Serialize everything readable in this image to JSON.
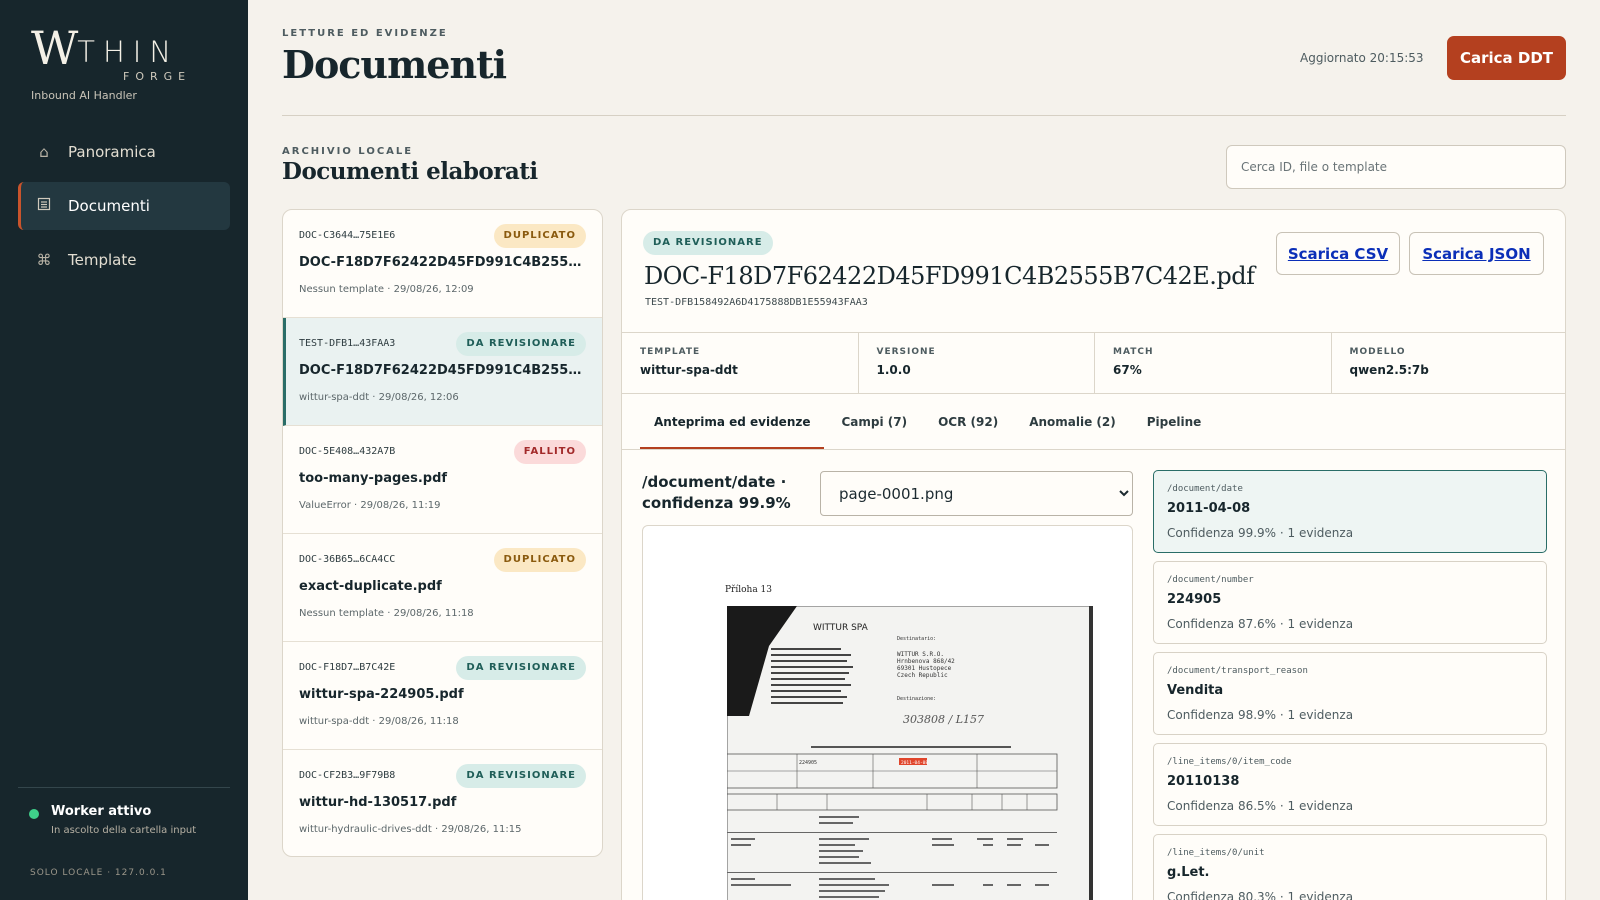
{
  "sidebar": {
    "brand": {
      "w": "W",
      "thin": "THIN",
      "forge": "FORGE",
      "subtitle": "Inbound AI Handler"
    },
    "nav": [
      {
        "label": "Panoramica",
        "icon": "home-icon",
        "active": false
      },
      {
        "label": "Documenti",
        "icon": "document-list-icon",
        "active": true
      },
      {
        "label": "Template",
        "icon": "command-icon",
        "active": false
      }
    ],
    "worker": {
      "title": "Worker attivo",
      "subtitle": "In ascolto della cartella input",
      "status_color": "#3fd08a"
    },
    "footer": "SOLO LOCALE · 127.0.0.1"
  },
  "header": {
    "eyebrow": "LETTURE ED EVIDENZE",
    "title": "Documenti",
    "updated": "Aggiornato 20:15:53",
    "upload_label": "Carica DDT"
  },
  "section": {
    "eyebrow": "ARCHIVIO LOCALE",
    "title": "Documenti elaborati",
    "search_placeholder": "Cerca ID, file o template"
  },
  "documents": [
    {
      "id": "DOC-C3644…75E1E6",
      "name": "DOC-F18D7F62422D45FD991C4B2555B7C42E.pdf",
      "meta": "Nessun template · 29/08/26, 12:09",
      "badge": "DUPLICATO",
      "badge_type": "dup",
      "selected": false
    },
    {
      "id": "TEST-DFB1…43FAA3",
      "name": "DOC-F18D7F62422D45FD991C4B2555B7C42E.pdf",
      "meta": "wittur-spa-ddt · 29/08/26, 12:06",
      "badge": "DA REVISIONARE",
      "badge_type": "rev",
      "selected": true
    },
    {
      "id": "DOC-5E408…432A7B",
      "name": "too-many-pages.pdf",
      "meta": "ValueError · 29/08/26, 11:19",
      "badge": "FALLITO",
      "badge_type": "fail",
      "selected": false
    },
    {
      "id": "DOC-36B65…6CA4CC",
      "name": "exact-duplicate.pdf",
      "meta": "Nessun template · 29/08/26, 11:18",
      "badge": "DUPLICATO",
      "badge_type": "dup",
      "selected": false
    },
    {
      "id": "DOC-F18D7…B7C42E",
      "name": "wittur-spa-224905.pdf",
      "meta": "wittur-spa-ddt · 29/08/26, 11:18",
      "badge": "DA REVISIONARE",
      "badge_type": "rev",
      "selected": false
    },
    {
      "id": "DOC-CF2B3…9F79B8",
      "name": "wittur-hd-130517.pdf",
      "meta": "wittur-hydraulic-drives-ddt · 29/08/26, 11:15",
      "badge": "DA REVISIONARE",
      "badge_type": "rev",
      "selected": false
    }
  ],
  "detail": {
    "badge": "DA REVISIONARE",
    "title": "DOC-F18D7F62422D45FD991C4B2555B7C42E.pdf",
    "subtitle": "TEST-DFB158492A6D4175888DB1E55943FAA3",
    "download_csv": "Scarica CSV",
    "download_json": "Scarica JSON",
    "meta": [
      {
        "label": "TEMPLATE",
        "value": "wittur-spa-ddt"
      },
      {
        "label": "VERSIONE",
        "value": "1.0.0"
      },
      {
        "label": "MATCH",
        "value": "67%"
      },
      {
        "label": "MODELLO",
        "value": "qwen2.5:7b"
      }
    ],
    "tabs": [
      {
        "label": "Anteprima ed evidenze",
        "active": true
      },
      {
        "label": "Campi (7)",
        "active": false
      },
      {
        "label": "OCR (92)",
        "active": false
      },
      {
        "label": "Anomalie (2)",
        "active": false
      },
      {
        "label": "Pipeline",
        "active": false
      }
    ],
    "evidence_title": "/document/date · confidenza 99.9%",
    "page_select": {
      "selected": "page-0001.png"
    },
    "preview": {
      "page_label": "Příloha 13",
      "company": "WITTUR SPA",
      "recipient_label": "Destinatario:",
      "recipient_lines": [
        "WITTUR S.R.O.",
        "Hrnbenova 868/42",
        "69301 Hustopece",
        "Czech Republic"
      ],
      "destination_label": "Destinazione:",
      "handwriting": "303808 / L157",
      "highlight": "2011-04-08",
      "ocr_number": "224905"
    },
    "fields": [
      {
        "path": "/document/date",
        "value": "2011-04-08",
        "confidence": "Confidenza 99.9% · 1 evidenza",
        "active": true
      },
      {
        "path": "/document/number",
        "value": "224905",
        "confidence": "Confidenza 87.6% · 1 evidenza",
        "active": false
      },
      {
        "path": "/document/transport_reason",
        "value": "Vendita",
        "confidence": "Confidenza 98.9% · 1 evidenza",
        "active": false
      },
      {
        "path": "/line_items/0/item_code",
        "value": "20110138",
        "confidence": "Confidenza 86.5% · 1 evidenza",
        "active": false
      },
      {
        "path": "/line_items/0/unit",
        "value": "g.Let.",
        "confidence": "Confidenza 80.3% · 1 evidenza",
        "active": false
      }
    ]
  },
  "colors": {
    "sidebar": "#17262c",
    "accent": "#b4401f",
    "review": "#d7ece8",
    "duplicate": "#fbe8c4",
    "failed": "#fbdada"
  }
}
